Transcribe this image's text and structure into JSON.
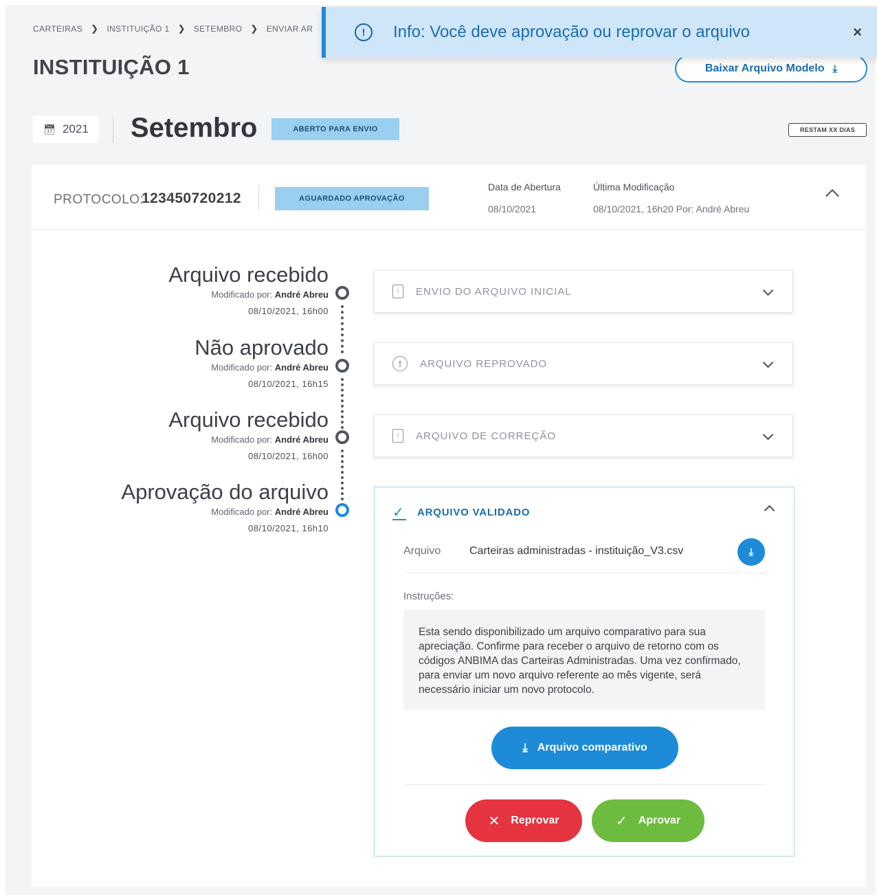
{
  "breadcrumb": [
    "CARTEIRAS",
    "INSTITUIÇÃO 1",
    "SETEMBRO",
    "ENVIAR AR"
  ],
  "breadcrumb_sep": "❯",
  "page_title": "INSTITUIÇÃO 1",
  "toast": {
    "message": "Info: Você deve aprovação ou reprovar o arquivo",
    "icon": "info-icon",
    "close": "×"
  },
  "download_model_label": "Baixar Arquivo Modelo",
  "year": "2021",
  "month": "Setembro",
  "period_status": "ABERTO PARA ENVIO",
  "days_left": "RESTAM XX DIAS",
  "protocol": {
    "label": "PROTOCOLO:",
    "value": "123450720212",
    "status": "AGUARDADO APROVAÇÃO",
    "opened_label": "Data de Abertura",
    "opened_value": "08/10/2021",
    "modified_label": "Última Modificação",
    "modified_value": "08/10/2021, 16h20 Por: André Abreu"
  },
  "timeline": [
    {
      "title": "Arquivo recebido",
      "by_prefix": "Modificado por:",
      "by": "André Abreu",
      "date": "08/10/2021, 16h00"
    },
    {
      "title": "Não aprovado",
      "by_prefix": "Modificado por:",
      "by": "André Abreu",
      "date": "08/10/2021, 16h15"
    },
    {
      "title": "Arquivo recebido",
      "by_prefix": "Modificado por:",
      "by": "André Abreu",
      "date": "08/10/2021, 16h00"
    },
    {
      "title": "Aprovação do arquivo",
      "by_prefix": "Modificado por:",
      "by": "André Abreu",
      "date": "08/10/2021, 16h10"
    }
  ],
  "panels": [
    {
      "label": "ENVIO DO ARQUIVO INICIAL",
      "icon": "file-upload-icon"
    },
    {
      "label": "ARQUIVO REPROVADO",
      "icon": "alert-icon"
    },
    {
      "label": "ARQUIVO DE CORREÇÃO",
      "icon": "file-upload-icon"
    }
  ],
  "validated": {
    "label": "ARQUIVO VALIDADO",
    "file_label": "Arquivo",
    "file_name": "Carteiras administradas -  instituição_V3.csv",
    "instructions_label": "Instruções:",
    "instructions": "Esta sendo disponibilizado um arquivo comparativo para sua apreciação. Confirme para receber o arquivo de retorno com os códigos ANBIMA das Carteiras Administradas. Uma vez confirmado, para enviar um novo arquivo referente ao mês vigente, será necessário iniciar um novo protocolo.",
    "compare_button": "Arquivo comparativo",
    "reject_button": "Reprovar",
    "approve_button": "Aprovar"
  },
  "colors": {
    "accent": "#1d8bd8",
    "reject": "#e5333f",
    "approve": "#6dbb3f",
    "badge": "#9bcfef"
  }
}
